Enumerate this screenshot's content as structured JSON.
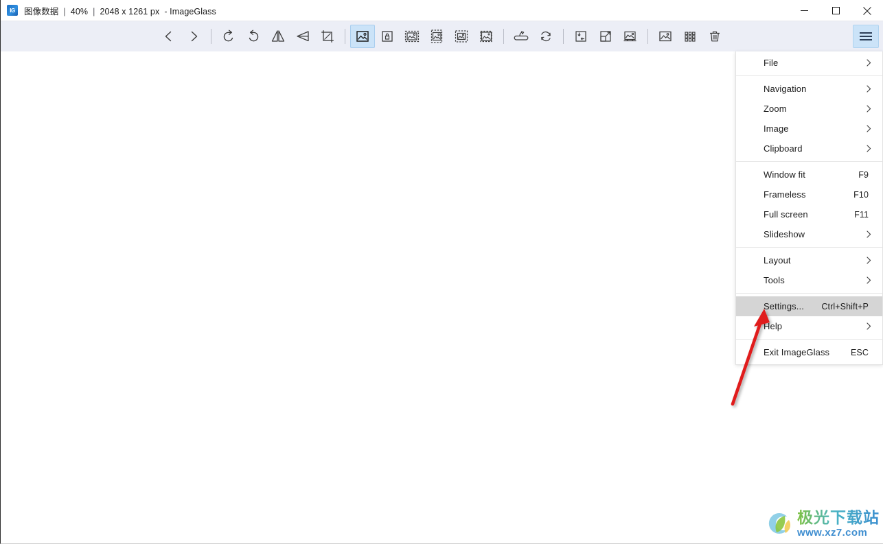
{
  "window": {
    "app_icon": "imageglass-app-icon",
    "title_parts": {
      "filename": "图像数据",
      "zoom_level": "40%",
      "dimensions": "2048 x 1261 px",
      "app_name": "- ImageGlass",
      "separator": "|"
    },
    "controls": [
      {
        "name": "minimize-button",
        "icon": "minimize-icon"
      },
      {
        "name": "maximize-button",
        "icon": "maximize-icon"
      },
      {
        "name": "close-button",
        "icon": "close-icon"
      }
    ]
  },
  "toolbar": {
    "buttons": [
      {
        "name": "previous-image-button",
        "icon": "chevron-left-icon",
        "active": false
      },
      {
        "name": "next-image-button",
        "icon": "chevron-right-icon",
        "active": false
      },
      {
        "name": "separator-1",
        "icon": "separator",
        "active": false
      },
      {
        "name": "rotate-left-button",
        "icon": "rotate-left-icon",
        "active": false
      },
      {
        "name": "rotate-right-button",
        "icon": "rotate-right-icon",
        "active": false
      },
      {
        "name": "flip-horizontal-button",
        "icon": "flip-horizontal-icon",
        "active": false
      },
      {
        "name": "flip-vertical-button",
        "icon": "flip-vertical-icon",
        "active": false
      },
      {
        "name": "crop-button",
        "icon": "crop-icon",
        "active": false
      },
      {
        "name": "separator-2",
        "icon": "separator",
        "active": false
      },
      {
        "name": "auto-zoom-button",
        "icon": "auto-zoom-image-icon",
        "active": true
      },
      {
        "name": "lock-zoom-button",
        "icon": "lock-zoom-icon",
        "active": false
      },
      {
        "name": "scale-to-width-button",
        "icon": "scale-width-icon",
        "active": false
      },
      {
        "name": "scale-to-height-button",
        "icon": "scale-height-icon",
        "active": false
      },
      {
        "name": "scale-to-fit-button",
        "icon": "scale-fit-icon",
        "active": false
      },
      {
        "name": "scale-to-fill-button",
        "icon": "scale-fill-icon",
        "active": false
      },
      {
        "name": "separator-3",
        "icon": "separator",
        "active": false
      },
      {
        "name": "open-with-button",
        "icon": "open-with-icon",
        "active": false
      },
      {
        "name": "refresh-button",
        "icon": "refresh-icon",
        "active": false
      },
      {
        "name": "separator-4",
        "icon": "separator",
        "active": false
      },
      {
        "name": "save-as-button",
        "icon": "save-as-icon",
        "active": false
      },
      {
        "name": "actual-size-button",
        "icon": "actual-size-icon",
        "active": false
      },
      {
        "name": "set-desktop-background-button",
        "icon": "set-wallpaper-icon",
        "active": false
      },
      {
        "name": "separator-5",
        "icon": "separator",
        "active": false
      },
      {
        "name": "edit-image-button",
        "icon": "edit-image-icon",
        "active": false
      },
      {
        "name": "thumbnail-panel-button",
        "icon": "grid-thumbnails-icon",
        "active": false
      },
      {
        "name": "delete-button",
        "icon": "trash-icon",
        "active": false
      }
    ],
    "main_menu_button": {
      "name": "main-menu-button",
      "icon": "hamburger-icon"
    }
  },
  "menu": {
    "groups": [
      {
        "items": [
          {
            "label": "File",
            "shortcut": "",
            "submenu": true,
            "highlight": false
          }
        ]
      },
      {
        "items": [
          {
            "label": "Navigation",
            "shortcut": "",
            "submenu": true,
            "highlight": false
          },
          {
            "label": "Zoom",
            "shortcut": "",
            "submenu": true,
            "highlight": false
          },
          {
            "label": "Image",
            "shortcut": "",
            "submenu": true,
            "highlight": false
          },
          {
            "label": "Clipboard",
            "shortcut": "",
            "submenu": true,
            "highlight": false
          }
        ]
      },
      {
        "items": [
          {
            "label": "Window fit",
            "shortcut": "F9",
            "submenu": false,
            "highlight": false
          },
          {
            "label": "Frameless",
            "shortcut": "F10",
            "submenu": false,
            "highlight": false
          },
          {
            "label": "Full screen",
            "shortcut": "F11",
            "submenu": false,
            "highlight": false
          },
          {
            "label": "Slideshow",
            "shortcut": "",
            "submenu": true,
            "highlight": false
          }
        ]
      },
      {
        "items": [
          {
            "label": "Layout",
            "shortcut": "",
            "submenu": true,
            "highlight": false
          },
          {
            "label": "Tools",
            "shortcut": "",
            "submenu": true,
            "highlight": false
          }
        ]
      },
      {
        "items": [
          {
            "label": "Settings...",
            "shortcut": "Ctrl+Shift+P",
            "submenu": false,
            "highlight": true
          },
          {
            "label": "Help",
            "shortcut": "",
            "submenu": true,
            "highlight": false
          }
        ]
      },
      {
        "items": [
          {
            "label": "Exit ImageGlass",
            "shortcut": "ESC",
            "submenu": false,
            "highlight": false
          }
        ]
      }
    ]
  },
  "annotation": {
    "arrow": {
      "name": "red-pointer-arrow",
      "color": "#e01b1b",
      "points_to": "Settings..."
    }
  },
  "watermark": {
    "brand_cn": "极光下载站",
    "url": "www.xz7.com",
    "logo": "g-swirl-logo"
  },
  "colors": {
    "toolbar_bg": "#eceef6",
    "active_button_bg": "#cbe3f8",
    "menu_bg": "#ffffff",
    "menu_highlight": "#d5d5d5",
    "canvas_bg": "#ffffff",
    "arrow_red": "#e01b1b"
  }
}
